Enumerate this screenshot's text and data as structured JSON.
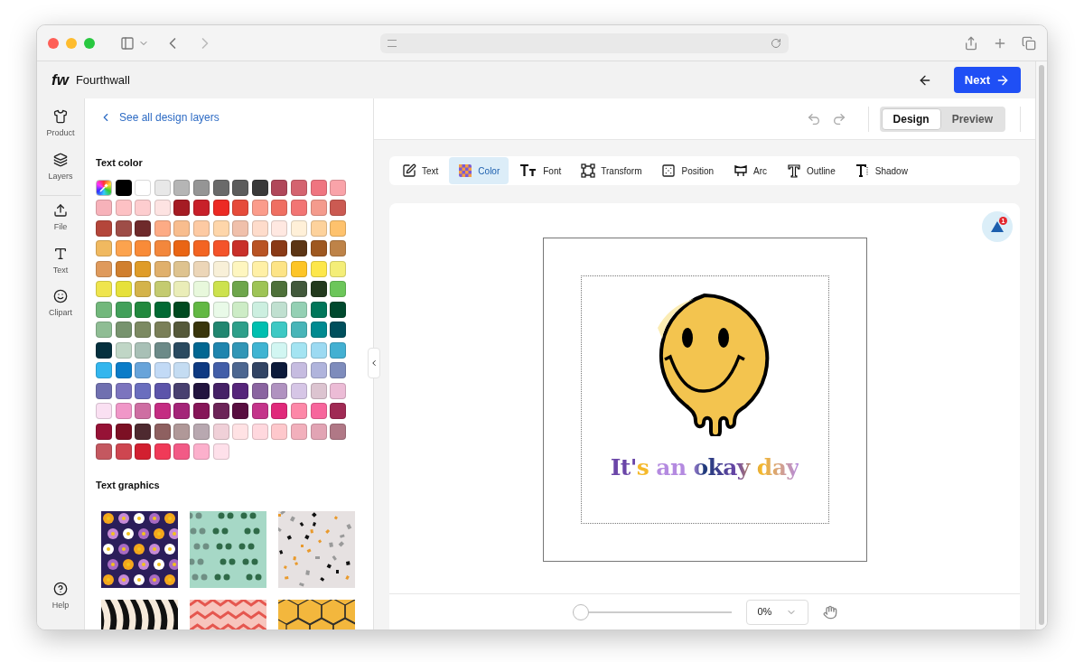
{
  "app": {
    "logo": "fw",
    "name": "Fourthwall",
    "next_button": "Next"
  },
  "nav": {
    "items": [
      {
        "label": "Product",
        "kind": "shirt"
      },
      {
        "label": "Layers",
        "kind": "layers"
      },
      {
        "label": "File",
        "kind": "upload"
      },
      {
        "label": "Text",
        "kind": "text"
      },
      {
        "label": "Clipart",
        "kind": "smile"
      }
    ],
    "help": "Help"
  },
  "panel": {
    "back_link": "See all design layers",
    "text_color_title": "Text color",
    "swatch_rows": [
      [
        {
          "kind": "picker"
        },
        {
          "kind": "color",
          "color": "#000000"
        },
        {
          "kind": "color",
          "color": "#ffffff"
        },
        {
          "kind": "color",
          "color": "#e8e8e8"
        },
        {
          "kind": "color",
          "color": "#b5b5b5"
        },
        {
          "kind": "color",
          "color": "#959595"
        },
        {
          "kind": "color",
          "color": "#6a6a6a"
        },
        {
          "kind": "color",
          "color": "#5c5c5c"
        },
        {
          "kind": "color",
          "color": "#3a3a3a"
        },
        {
          "kind": "color",
          "color": "#b0475a"
        },
        {
          "kind": "color",
          "color": "#d4636f"
        },
        {
          "kind": "color",
          "color": "#ef7580"
        },
        {
          "kind": "color",
          "color": "#f9a3a9"
        }
      ],
      [
        {
          "kind": "color",
          "color": "#f7b2ba"
        },
        {
          "kind": "color",
          "color": "#fdc1c4"
        },
        {
          "kind": "color",
          "color": "#fdcdcf"
        },
        {
          "kind": "color",
          "color": "#fde3e2"
        },
        {
          "kind": "color",
          "color": "#a51c24"
        },
        {
          "kind": "color",
          "color": "#c8202a"
        },
        {
          "kind": "color",
          "color": "#ec2a24"
        },
        {
          "kind": "color",
          "color": "#e64b3a"
        },
        {
          "kind": "color",
          "color": "#fb9c8b"
        },
        {
          "kind": "color",
          "color": "#ef6f62"
        },
        {
          "kind": "color",
          "color": "#f27574"
        },
        {
          "kind": "color",
          "color": "#f49b8d"
        },
        {
          "kind": "color",
          "color": "#cb5a52"
        }
      ],
      [
        {
          "kind": "color",
          "color": "#b4463a"
        },
        {
          "kind": "color",
          "color": "#9e4d47"
        },
        {
          "kind": "color",
          "color": "#6e2a2b"
        },
        {
          "kind": "color",
          "color": "#fdab85"
        },
        {
          "kind": "color",
          "color": "#f8bd8e"
        },
        {
          "kind": "color",
          "color": "#fdcaa3"
        },
        {
          "kind": "color",
          "color": "#fed6aa"
        },
        {
          "kind": "color",
          "color": "#f0c0ab"
        },
        {
          "kind": "color",
          "color": "#fedccb"
        },
        {
          "kind": "color",
          "color": "#ffe8e1"
        },
        {
          "kind": "color",
          "color": "#fff0d8"
        },
        {
          "kind": "color",
          "color": "#fdd29c"
        },
        {
          "kind": "color",
          "color": "#fec26d"
        }
      ],
      [
        {
          "kind": "color",
          "color": "#f0b960"
        },
        {
          "kind": "color",
          "color": "#fca34e"
        },
        {
          "kind": "color",
          "color": "#f98b38"
        },
        {
          "kind": "color",
          "color": "#f3873c"
        },
        {
          "kind": "color",
          "color": "#ea6514"
        },
        {
          "kind": "color",
          "color": "#f36422"
        },
        {
          "kind": "color",
          "color": "#f4532a"
        },
        {
          "kind": "color",
          "color": "#c9302a"
        },
        {
          "kind": "color",
          "color": "#b95424"
        },
        {
          "kind": "color",
          "color": "#8a3a16"
        },
        {
          "kind": "color",
          "color": "#5c3514"
        },
        {
          "kind": "color",
          "color": "#9e5820"
        },
        {
          "kind": "color",
          "color": "#be8348"
        }
      ],
      [
        {
          "kind": "color",
          "color": "#df9a5c"
        },
        {
          "kind": "color",
          "color": "#d07f2e"
        },
        {
          "kind": "color",
          "color": "#df9c28"
        },
        {
          "kind": "color",
          "color": "#e0b06c"
        },
        {
          "kind": "color",
          "color": "#dec38f"
        },
        {
          "kind": "color",
          "color": "#ecd6b8"
        },
        {
          "kind": "color",
          "color": "#f8f0d8"
        },
        {
          "kind": "color",
          "color": "#fef6c0"
        },
        {
          "kind": "color",
          "color": "#fff0a6"
        },
        {
          "kind": "color",
          "color": "#fde486"
        },
        {
          "kind": "color",
          "color": "#fdc526"
        },
        {
          "kind": "color",
          "color": "#fde74a"
        },
        {
          "kind": "color",
          "color": "#f4ee78"
        }
      ],
      [
        {
          "kind": "color",
          "color": "#efe54e"
        },
        {
          "kind": "color",
          "color": "#e6e13a"
        },
        {
          "kind": "color",
          "color": "#d4b34a"
        },
        {
          "kind": "color",
          "color": "#c4cb70"
        },
        {
          "kind": "color",
          "color": "#eaedb8"
        },
        {
          "kind": "color",
          "color": "#e8f8dc"
        },
        {
          "kind": "color",
          "color": "#cde24e"
        },
        {
          "kind": "color",
          "color": "#6ea64c"
        },
        {
          "kind": "color",
          "color": "#9ec456"
        },
        {
          "kind": "color",
          "color": "#4e713a"
        },
        {
          "kind": "color",
          "color": "#42593c"
        },
        {
          "kind": "color",
          "color": "#233a1e"
        },
        {
          "kind": "color",
          "color": "#6cc65a"
        }
      ],
      [
        {
          "kind": "color",
          "color": "#72b87c"
        },
        {
          "kind": "color",
          "color": "#42a05a"
        },
        {
          "kind": "color",
          "color": "#22893e"
        },
        {
          "kind": "color",
          "color": "#026a34"
        },
        {
          "kind": "color",
          "color": "#004a20"
        },
        {
          "kind": "color",
          "color": "#62b843"
        },
        {
          "kind": "color",
          "color": "#e9fae8"
        },
        {
          "kind": "color",
          "color": "#cdecc6"
        },
        {
          "kind": "color",
          "color": "#ccefe0"
        },
        {
          "kind": "color",
          "color": "#c0e0d0"
        },
        {
          "kind": "color",
          "color": "#94d0b4"
        },
        {
          "kind": "color",
          "color": "#00765a"
        },
        {
          "kind": "color",
          "color": "#00492e"
        }
      ],
      [
        {
          "kind": "color",
          "color": "#8fbd94"
        },
        {
          "kind": "color",
          "color": "#77936e"
        },
        {
          "kind": "color",
          "color": "#7c8a62"
        },
        {
          "kind": "color",
          "color": "#7a7f58"
        },
        {
          "kind": "color",
          "color": "#55593a"
        },
        {
          "kind": "color",
          "color": "#39350c"
        },
        {
          "kind": "color",
          "color": "#218670"
        },
        {
          "kind": "color",
          "color": "#2e9f8a"
        },
        {
          "kind": "color",
          "color": "#00bfb0"
        },
        {
          "kind": "color",
          "color": "#3ec9c4"
        },
        {
          "kind": "color",
          "color": "#48b5b8"
        },
        {
          "kind": "color",
          "color": "#008a90"
        },
        {
          "kind": "color",
          "color": "#004f5c"
        }
      ],
      [
        {
          "kind": "color",
          "color": "#05303e"
        },
        {
          "kind": "color",
          "color": "#c0d6c6"
        },
        {
          "kind": "color",
          "color": "#a8c0b6"
        },
        {
          "kind": "color",
          "color": "#6c8a88"
        },
        {
          "kind": "color",
          "color": "#2a4a60"
        },
        {
          "kind": "color",
          "color": "#026792"
        },
        {
          "kind": "color",
          "color": "#1f85ae"
        },
        {
          "kind": "color",
          "color": "#3196b6"
        },
        {
          "kind": "color",
          "color": "#3fb4d2"
        },
        {
          "kind": "color",
          "color": "#d2f6f2"
        },
        {
          "kind": "color",
          "color": "#a4e4f2"
        },
        {
          "kind": "color",
          "color": "#9cdaf2"
        },
        {
          "kind": "color",
          "color": "#43b0d2"
        }
      ],
      [
        {
          "kind": "color",
          "color": "#33b6ee"
        },
        {
          "kind": "color",
          "color": "#0a7cc8"
        },
        {
          "kind": "color",
          "color": "#68a4da"
        },
        {
          "kind": "color",
          "color": "#c2daf6"
        },
        {
          "kind": "color",
          "color": "#c4dcf2"
        },
        {
          "kind": "color",
          "color": "#0e3a82"
        },
        {
          "kind": "color",
          "color": "#425ea8"
        },
        {
          "kind": "color",
          "color": "#4c6690"
        },
        {
          "kind": "color",
          "color": "#324464"
        },
        {
          "kind": "color",
          "color": "#0c1a3a"
        },
        {
          "kind": "color",
          "color": "#c6bce0"
        },
        {
          "kind": "color",
          "color": "#b0b4dc"
        },
        {
          "kind": "color",
          "color": "#7e8cbc"
        }
      ],
      [
        {
          "kind": "color",
          "color": "#7070b0"
        },
        {
          "kind": "color",
          "color": "#7c74be"
        },
        {
          "kind": "color",
          "color": "#6a6ebe"
        },
        {
          "kind": "color",
          "color": "#5c54aa"
        },
        {
          "kind": "color",
          "color": "#484070"
        },
        {
          "kind": "color",
          "color": "#22143e"
        },
        {
          "kind": "color",
          "color": "#452166"
        },
        {
          "kind": "color",
          "color": "#55257a"
        },
        {
          "kind": "color",
          "color": "#8a64a0"
        },
        {
          "kind": "color",
          "color": "#b092c0"
        },
        {
          "kind": "color",
          "color": "#d6c6e6"
        },
        {
          "kind": "color",
          "color": "#dcc4d0"
        },
        {
          "kind": "color",
          "color": "#ecbcd6"
        }
      ],
      [
        {
          "kind": "color",
          "color": "#fae0f2"
        },
        {
          "kind": "color",
          "color": "#f097c8"
        },
        {
          "kind": "color",
          "color": "#ce6ea2"
        },
        {
          "kind": "color",
          "color": "#c42c82"
        },
        {
          "kind": "color",
          "color": "#a42478"
        },
        {
          "kind": "color",
          "color": "#861658"
        },
        {
          "kind": "color",
          "color": "#6c2458"
        },
        {
          "kind": "color",
          "color": "#580e40"
        },
        {
          "kind": "color",
          "color": "#c4348a"
        },
        {
          "kind": "color",
          "color": "#e0297a"
        },
        {
          "kind": "color",
          "color": "#fd88a8"
        },
        {
          "kind": "color",
          "color": "#f7669c"
        },
        {
          "kind": "color",
          "color": "#a02a54"
        }
      ],
      [
        {
          "kind": "color",
          "color": "#961236"
        },
        {
          "kind": "color",
          "color": "#7c1024"
        },
        {
          "kind": "color",
          "color": "#4e2a30"
        },
        {
          "kind": "color",
          "color": "#8e6060"
        },
        {
          "kind": "color",
          "color": "#b09898"
        },
        {
          "kind": "color",
          "color": "#b8a8b0"
        },
        {
          "kind": "color",
          "color": "#f0d0d8"
        },
        {
          "kind": "color",
          "color": "#ffe2e4"
        },
        {
          "kind": "color",
          "color": "#ffd8de"
        },
        {
          "kind": "color",
          "color": "#fec8cc"
        },
        {
          "kind": "color",
          "color": "#f2b0bc"
        },
        {
          "kind": "color",
          "color": "#e2a4b4"
        },
        {
          "kind": "color",
          "color": "#b07886"
        }
      ],
      [
        {
          "kind": "color",
          "color": "#c45860"
        },
        {
          "kind": "color",
          "color": "#ce4650"
        },
        {
          "kind": "color",
          "color": "#d21f30"
        },
        {
          "kind": "color",
          "color": "#f03a58"
        },
        {
          "kind": "color",
          "color": "#f25a86"
        },
        {
          "kind": "color",
          "color": "#fcb0cc"
        },
        {
          "kind": "color",
          "color": "#fee0ea"
        }
      ]
    ],
    "text_graphics_title": "Text graphics",
    "graphics": [
      {
        "kind": "floral"
      },
      {
        "kind": "leaves"
      },
      {
        "kind": "terrazzo"
      },
      {
        "kind": "zebra"
      },
      {
        "kind": "chevron"
      },
      {
        "kind": "hexagon"
      }
    ]
  },
  "view_toggle": [
    {
      "label": "Design",
      "selected": true
    },
    {
      "label": "Preview",
      "selected": false
    }
  ],
  "tools": [
    {
      "label": "Text",
      "kind": "edit",
      "selected": false
    },
    {
      "label": "Color",
      "kind": "color",
      "selected": true
    },
    {
      "label": "Font",
      "kind": "font",
      "selected": false
    },
    {
      "label": "Transform",
      "kind": "transform",
      "selected": false
    },
    {
      "label": "Position",
      "kind": "position",
      "selected": false
    },
    {
      "label": "Arc",
      "kind": "arc",
      "selected": false
    },
    {
      "label": "Outline",
      "kind": "outline",
      "selected": false
    },
    {
      "label": "Shadow",
      "kind": "shadow",
      "selected": false
    }
  ],
  "canvas": {
    "design_text": "It's an okay day",
    "warning_count": "1"
  },
  "zoom": {
    "level": 0,
    "reading": "0%"
  }
}
